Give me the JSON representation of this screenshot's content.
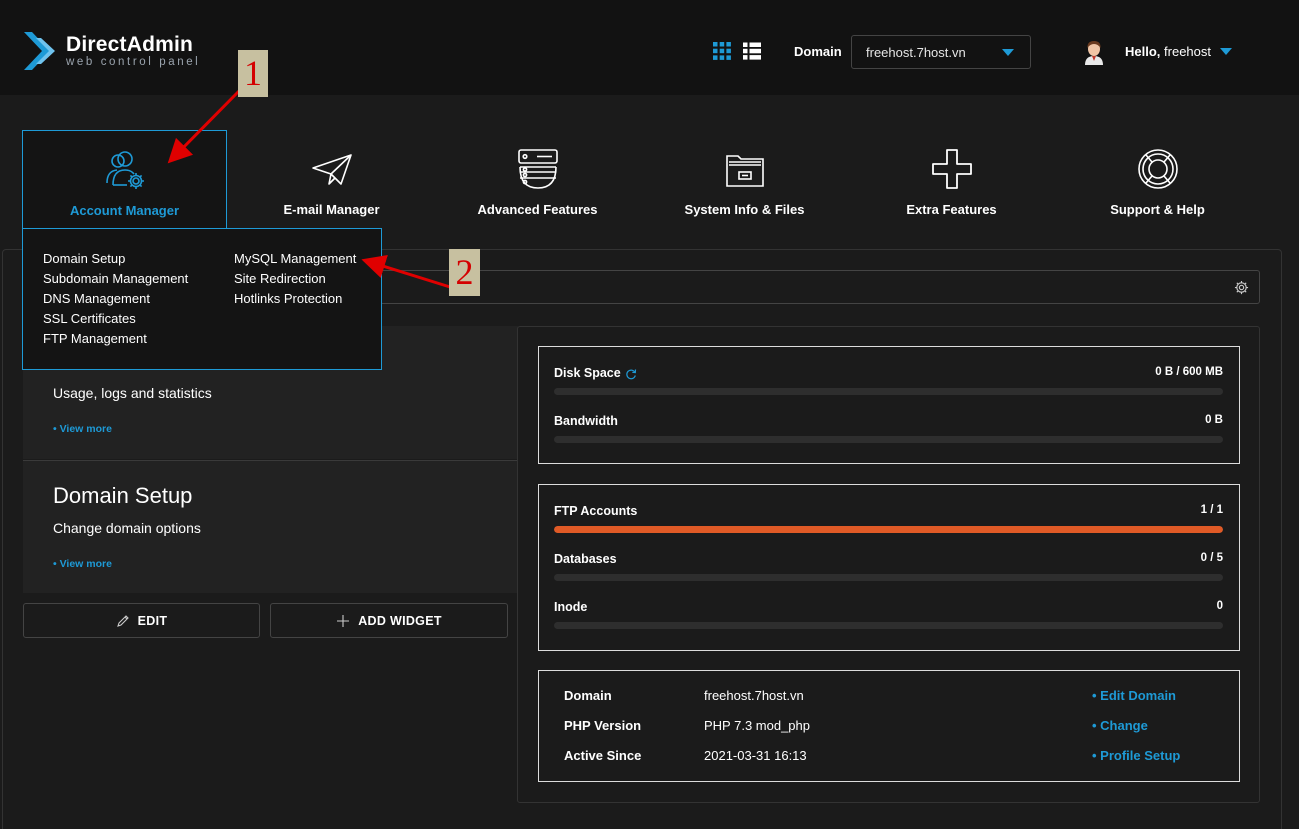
{
  "header": {
    "logo_title": "DirectAdmin",
    "logo_subtitle": "web control panel",
    "domain_label": "Domain",
    "domain_selected": "freehost.7host.vn",
    "hello_prefix": "Hello,",
    "username": "freehost"
  },
  "nav": {
    "items": [
      {
        "label": "Account Manager",
        "icon": "account-manager-icon"
      },
      {
        "label": "E-mail Manager",
        "icon": "paper-plane-icon"
      },
      {
        "label": "Advanced Features",
        "icon": "server-icon"
      },
      {
        "label": "System Info & Files",
        "icon": "folder-icon"
      },
      {
        "label": "Extra Features",
        "icon": "plus-icon"
      },
      {
        "label": "Support & Help",
        "icon": "lifebuoy-icon"
      }
    ]
  },
  "dropdown": {
    "col1": [
      "Domain Setup",
      "Subdomain Management",
      "DNS Management",
      "SSL Certificates",
      "FTP Management"
    ],
    "col2": [
      "MySQL Management",
      "Site Redirection",
      "Hotlinks Protection"
    ]
  },
  "widgets": {
    "w1": {
      "desc": "Usage, logs and statistics",
      "more": "• View more"
    },
    "w2": {
      "title": "Domain Setup",
      "desc": "Change domain options",
      "more": "• View more"
    }
  },
  "buttons": {
    "edit": "EDIT",
    "add_widget": "ADD WIDGET"
  },
  "stats": {
    "disk_label": "Disk Space",
    "disk_val": "0 B / 600 MB",
    "bw_label": "Bandwidth",
    "bw_val": "0 B",
    "ftp_label": "FTP Accounts",
    "ftp_val": "1 / 1",
    "ftp_fill": 1.0,
    "db_label": "Databases",
    "db_val": "0 / 5",
    "inode_label": "Inode",
    "inode_val": "0"
  },
  "info": {
    "rows": [
      {
        "key": "Domain",
        "value": "freehost.7host.vn",
        "link": "• Edit Domain"
      },
      {
        "key": "PHP Version",
        "value": "PHP 7.3 mod_php",
        "link": "• Change"
      },
      {
        "key": "Active Since",
        "value": "2021-03-31 16:13",
        "link": "• Profile Setup"
      }
    ]
  },
  "annotations": {
    "one": "1",
    "two": "2"
  },
  "colors": {
    "accent": "#1e9ad6",
    "bar_fill": "#e05a26",
    "annotation": "#d40000"
  }
}
